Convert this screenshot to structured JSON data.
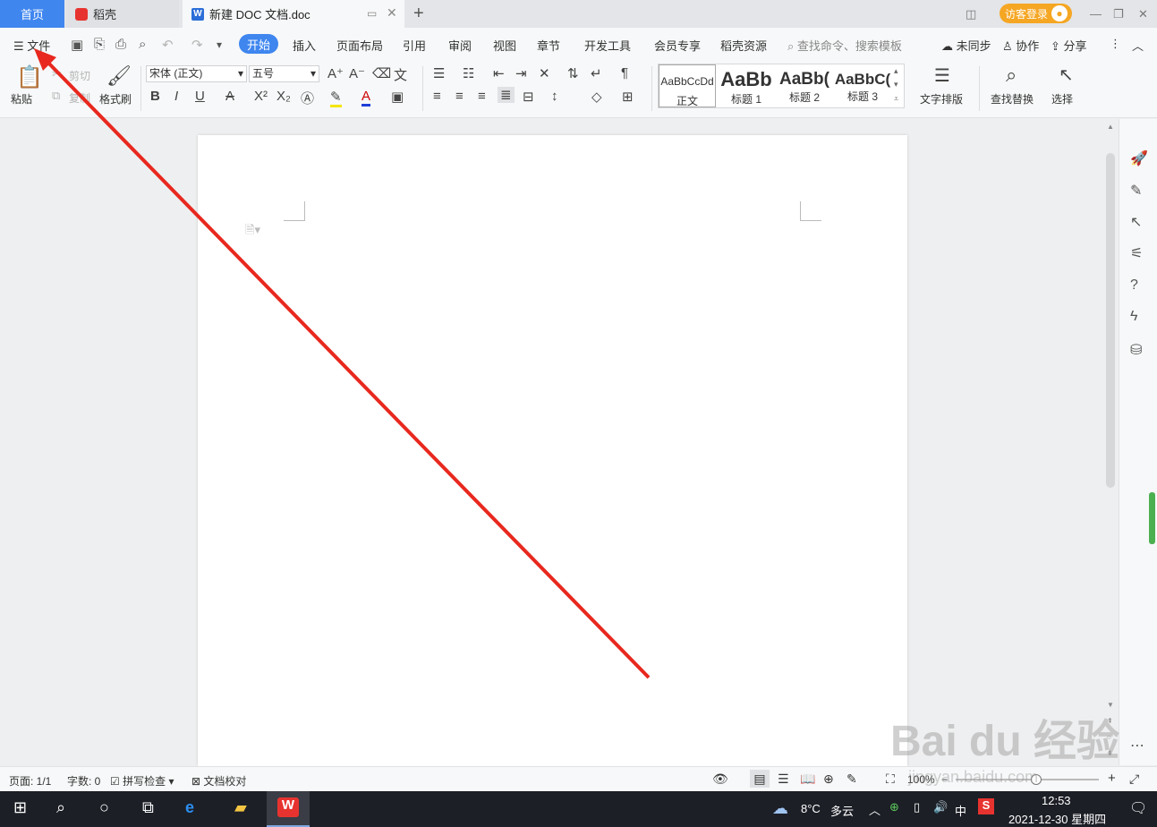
{
  "tabs": {
    "home": "首页",
    "daoke": "稻壳",
    "doc": "新建 DOC 文档.doc",
    "new_tab": "+",
    "login": "访客登录"
  },
  "menu": {
    "file": "文件",
    "items": [
      "开始",
      "插入",
      "页面布局",
      "引用",
      "审阅",
      "视图",
      "章节",
      "开发工具",
      "会员专享",
      "稻壳资源"
    ],
    "search_placeholder": "查找命令、搜索模板",
    "sync": "未同步",
    "collab": "协作",
    "share": "分享"
  },
  "ribbon": {
    "paste": "粘贴",
    "cut": "剪切",
    "copy": "复制",
    "format_painter": "格式刷",
    "font_name": "宋体 (正文)",
    "font_size": "五号",
    "styles": [
      {
        "preview": "AaBbCcDd",
        "label": "正文"
      },
      {
        "preview": "AaBb",
        "label": "标题 1"
      },
      {
        "preview": "AaBb(",
        "label": "标题 2"
      },
      {
        "preview": "AaBbC(",
        "label": "标题 3"
      }
    ],
    "text_layout": "文字排版",
    "find_replace": "查找替换",
    "select": "选择"
  },
  "status": {
    "page": "页面: 1/1",
    "word_count": "字数: 0",
    "spell_check": "拼写检查",
    "doc_proof": "文档校对",
    "zoom": "100%"
  },
  "taskbar": {
    "weather_temp": "8°C",
    "weather_desc": "多云",
    "ime": "中",
    "time": "12:53",
    "date": "2021-12-30 星期四"
  },
  "watermark": {
    "logo": "Bai du 经验",
    "url": "jingyan.baidu.com"
  },
  "colors": {
    "accent": "#3f86ef",
    "arrow": "#e8281e",
    "login_badge": "#f5a623"
  }
}
